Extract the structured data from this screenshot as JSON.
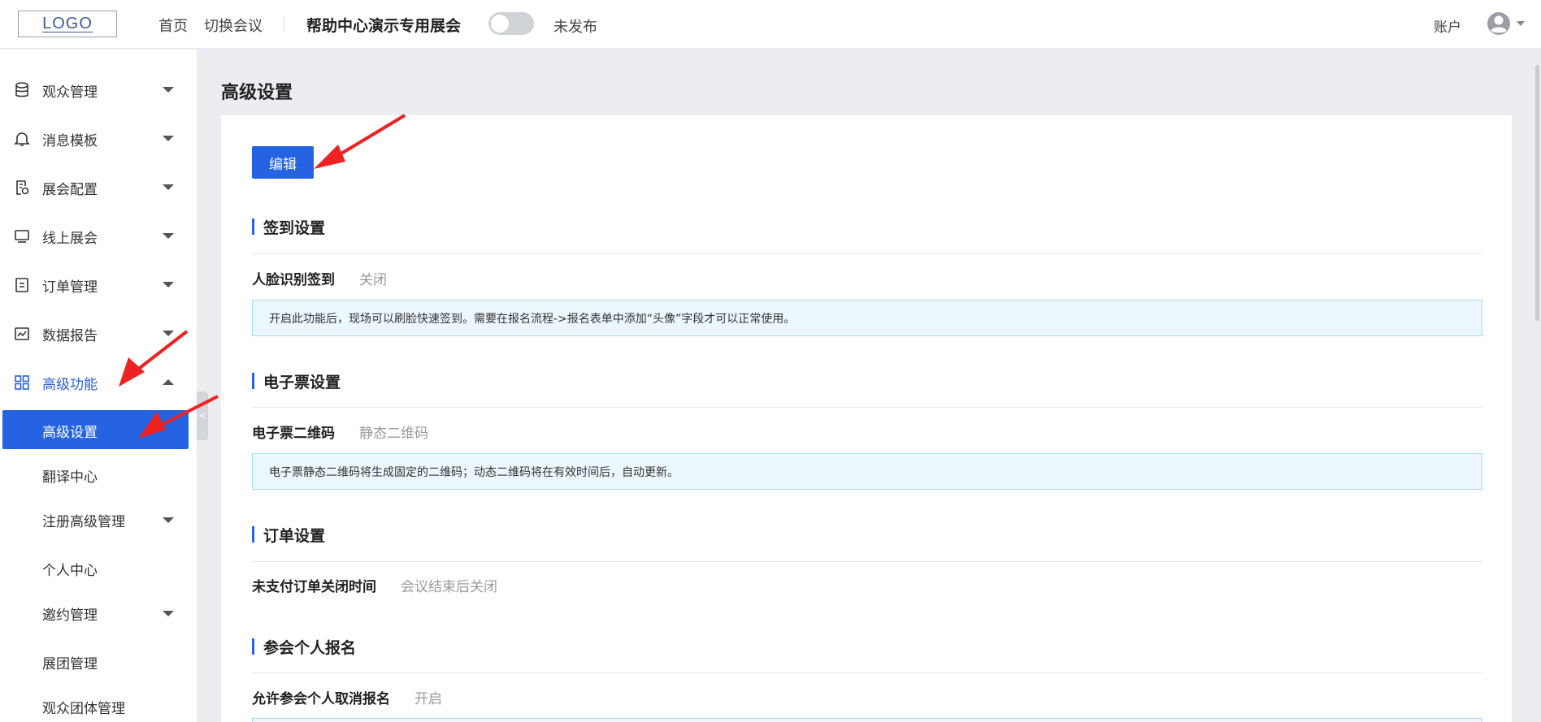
{
  "header": {
    "logo_text": "LOGO",
    "nav": [
      "首页",
      "切换会议"
    ],
    "expo_title": "帮助中心演示专用展会",
    "publish_status": "未发布",
    "account_label": "账户"
  },
  "sidebar": {
    "items": [
      {
        "label": "观众管理",
        "icon": "database-icon"
      },
      {
        "label": "消息模板",
        "icon": "bell-icon"
      },
      {
        "label": "展会配置",
        "icon": "doc-settings-icon"
      },
      {
        "label": "线上展会",
        "icon": "monitor-icon"
      },
      {
        "label": "订单管理",
        "icon": "order-doc-icon"
      },
      {
        "label": "数据报告",
        "icon": "chart-icon"
      },
      {
        "label": "高级功能",
        "icon": "grid-icon"
      }
    ],
    "sub_items": [
      "高级设置",
      "翻译中心",
      "注册高级管理",
      "个人中心",
      "邀约管理",
      "展团管理",
      "观众团体管理"
    ],
    "collapse_glyph": "<"
  },
  "main": {
    "page_title": "高级设置",
    "edit_button": "编辑",
    "sections": [
      {
        "title": "签到设置",
        "field": "人脸识别签到",
        "value": "关闭",
        "note": "开启此功能后，现场可以刷脸快速签到。需要在报名流程->报名表单中添加“头像”字段才可以正常使用。"
      },
      {
        "title": "电子票设置",
        "field": "电子票二维码",
        "value": "静态二维码",
        "note": "电子票静态二维码将生成固定的二维码；动态二维码将在有效时间后，自动更新。"
      },
      {
        "title": "订单设置",
        "field": "未支付订单关闭时间",
        "value": "会议结束后关闭"
      },
      {
        "title": "参会个人报名",
        "field": "允许参会个人取消报名",
        "value": "开启"
      }
    ]
  },
  "colors": {
    "accent": "#2563e3",
    "annotation": "#ee2222",
    "info_bg": "#ebf7fc"
  }
}
